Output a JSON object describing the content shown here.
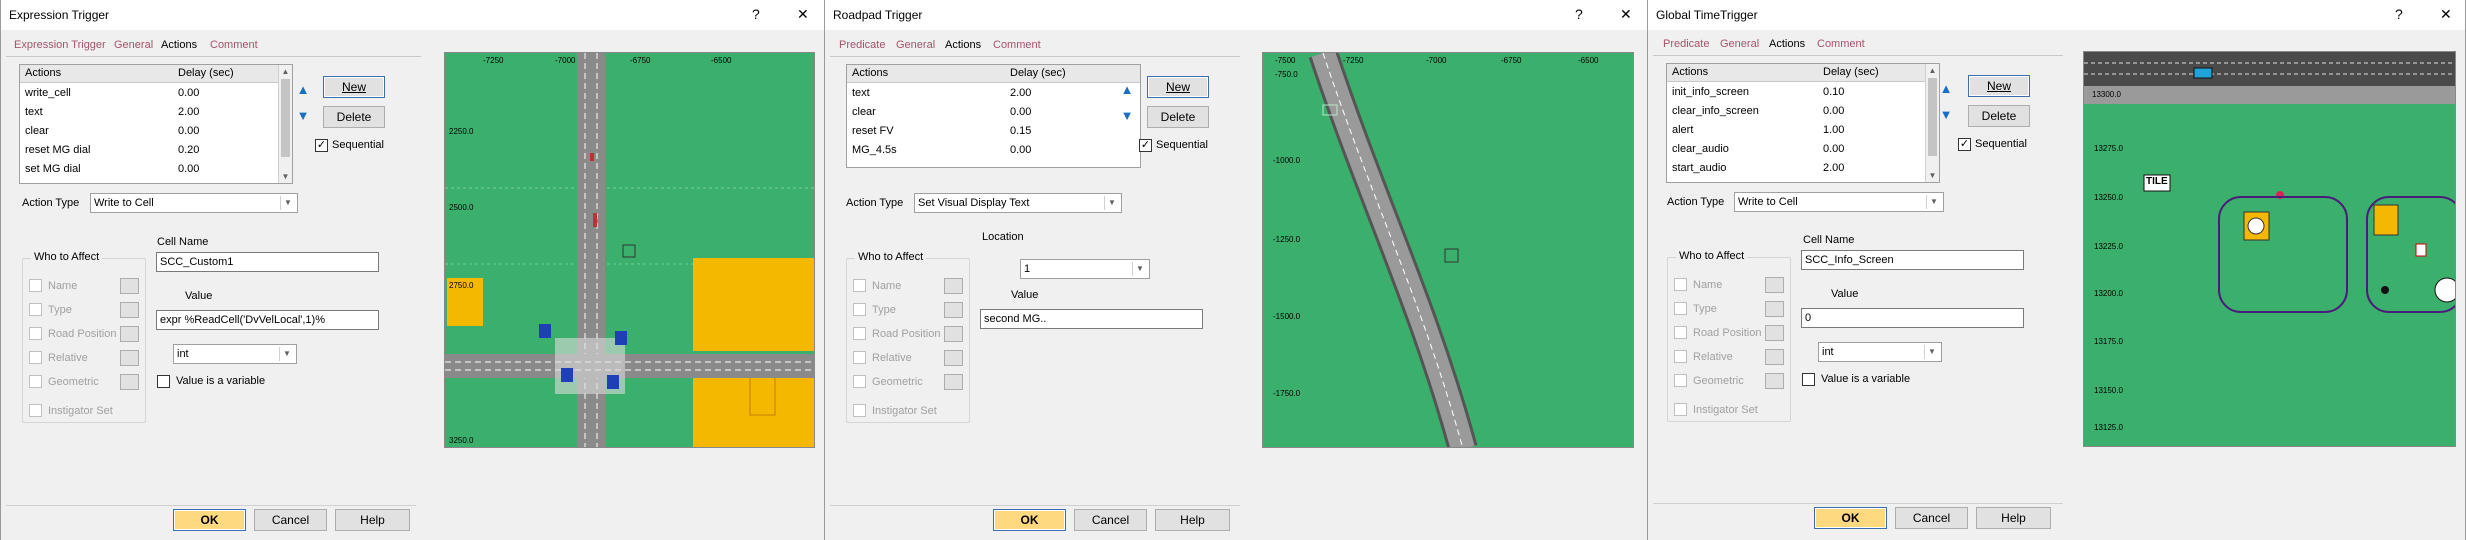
{
  "dialog1": {
    "title": "Expression Trigger",
    "help_glyph": "?",
    "close_glyph": "✕",
    "tabs": [
      "Expression Trigger",
      "General",
      "Actions",
      "Comment"
    ],
    "grid": {
      "col_actions": "Actions",
      "col_delay": "Delay (sec)",
      "rows": [
        {
          "action": "write_cell",
          "delay": "0.00"
        },
        {
          "action": "text",
          "delay": "2.00"
        },
        {
          "action": "clear",
          "delay": "0.00"
        },
        {
          "action": "reset MG dial",
          "delay": "0.20"
        },
        {
          "action": "set MG dial",
          "delay": "0.00"
        }
      ]
    },
    "new_label": "New",
    "delete_label": "Delete",
    "sequential_label": "Sequential",
    "action_type_label": "Action Type",
    "action_type_value": "Write to Cell",
    "who_label": "Who to Affect",
    "who_items": [
      "Name",
      "Type",
      "Road Position",
      "Relative",
      "Geometric"
    ],
    "instigator_label": "Instigator Set",
    "cell_name_label": "Cell Name",
    "cell_name_value": "SCC_Custom1",
    "value_label": "Value",
    "value_value": "expr %ReadCell('DvVelLocal',1)%",
    "type_value": "int",
    "is_variable_label": "Value is a variable",
    "ok_label": "OK",
    "cancel_label": "Cancel",
    "help_label": "Help",
    "map": {
      "x_ticks": [
        "-7250",
        "-7000",
        "-6750",
        "-6500"
      ],
      "y_ticks": [
        "2250.0",
        "2500.0",
        "2750.0",
        "3250.0"
      ]
    }
  },
  "dialog2": {
    "title": "Roadpad Trigger",
    "help_glyph": "?",
    "close_glyph": "✕",
    "tabs": [
      "Predicate",
      "General",
      "Actions",
      "Comment"
    ],
    "grid": {
      "col_actions": "Actions",
      "col_delay": "Delay (sec)",
      "rows": [
        {
          "action": "text",
          "delay": "2.00"
        },
        {
          "action": "clear",
          "delay": "0.00"
        },
        {
          "action": "reset FV",
          "delay": "0.15"
        },
        {
          "action": "MG_4.5s",
          "delay": "0.00"
        }
      ]
    },
    "new_label": "New",
    "delete_label": "Delete",
    "sequential_label": "Sequential",
    "action_type_label": "Action Type",
    "action_type_value": "Set Visual Display Text",
    "who_label": "Who to Affect",
    "who_items": [
      "Name",
      "Type",
      "Road Position",
      "Relative",
      "Geometric"
    ],
    "instigator_label": "Instigator Set",
    "location_label": "Location",
    "location_value": "1",
    "value_label": "Value",
    "value_value": "second MG..",
    "ok_label": "OK",
    "cancel_label": "Cancel",
    "help_label": "Help",
    "map": {
      "x_ticks": [
        "-7500",
        "-7250",
        "-7000",
        "-6750",
        "-6500"
      ],
      "y_ticks": [
        "-750.0",
        "-1000.0",
        "-1250.0",
        "-1500.0",
        "-1750.0"
      ]
    }
  },
  "dialog3": {
    "title": "Global TimeTrigger",
    "help_glyph": "?",
    "close_glyph": "✕",
    "tabs": [
      "Predicate",
      "General",
      "Actions",
      "Comment"
    ],
    "grid": {
      "col_actions": "Actions",
      "col_delay": "Delay (sec)",
      "rows": [
        {
          "action": "init_info_screen",
          "delay": "0.10"
        },
        {
          "action": "clear_info_screen",
          "delay": "0.00"
        },
        {
          "action": "alert",
          "delay": "1.00"
        },
        {
          "action": "clear_audio",
          "delay": "0.00"
        },
        {
          "action": "start_audio",
          "delay": "2.00"
        }
      ]
    },
    "new_label": "New",
    "delete_label": "Delete",
    "sequential_label": "Sequential",
    "action_type_label": "Action Type",
    "action_type_value": "Write to Cell",
    "who_label": "Who to Affect",
    "who_items": [
      "Name",
      "Type",
      "Road Position",
      "Relative",
      "Geometric"
    ],
    "instigator_label": "Instigator Set",
    "cell_name_label": "Cell Name",
    "cell_name_value": "SCC_Info_Screen",
    "value_label": "Value",
    "value_value": "0",
    "type_value": "int",
    "is_variable_label": "Value is a variable",
    "ok_label": "OK",
    "cancel_label": "Cancel",
    "help_label": "Help",
    "map": {
      "y_ticks": [
        "13300.0",
        "13275.0",
        "13250.0",
        "13225.0",
        "13200.0",
        "13175.0",
        "13150.0",
        "13125.0"
      ],
      "tile_label": "TILE"
    }
  },
  "colors": {
    "map_green": "#3bb06c",
    "road_gray": "#8a8a8a",
    "building_yellow": "#f5b800",
    "tab_inactive": "#a4546b",
    "arrow_blue": "#1a6fc4",
    "circle_purple": "#4b1d7a"
  }
}
